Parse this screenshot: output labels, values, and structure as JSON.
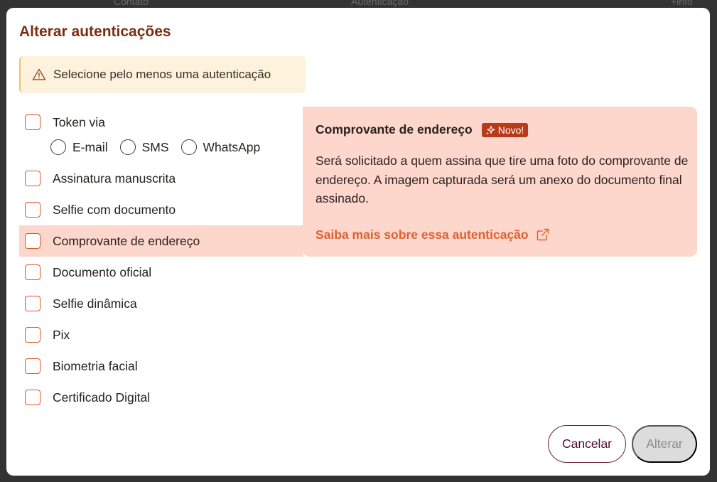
{
  "backdrop": {
    "col1": "Contato",
    "col2": "Autenticação",
    "col3": "+info"
  },
  "modal": {
    "title": "Alterar autenticações",
    "alert": {
      "icon": "warning-triangle-icon",
      "text": "Selecione pelo menos uma autenticação"
    },
    "options": [
      {
        "label": "Token via",
        "checked": false
      },
      {
        "label": "Assinatura manuscrita",
        "checked": false
      },
      {
        "label": "Selfie com documento",
        "checked": false
      },
      {
        "label": "Comprovante de endereço",
        "checked": false,
        "highlighted": true
      },
      {
        "label": "Documento oficial",
        "checked": false
      },
      {
        "label": "Selfie dinâmica",
        "checked": false
      },
      {
        "label": "Pix",
        "checked": false
      },
      {
        "label": "Biometria facial",
        "checked": false
      },
      {
        "label": "Certificado Digital",
        "checked": false
      }
    ],
    "token_channels": [
      {
        "label": "E-mail",
        "selected": false
      },
      {
        "label": "SMS",
        "selected": false
      },
      {
        "label": "WhatsApp",
        "selected": false
      }
    ],
    "info": {
      "title": "Comprovante de endereço",
      "badge": "Novo!",
      "badge_icon": "sparkles-icon",
      "description": "Será solicitado a quem assina que tire uma foto do comprovante de endereço. A imagem capturada será um anexo do documento final assinado.",
      "link_text": "Saiba mais sobre essa autenticação",
      "link_icon": "external-link-icon"
    },
    "buttons": {
      "cancel": "Cancelar",
      "confirm": "Alterar"
    }
  },
  "colors": {
    "title": "#7a2e12",
    "accent": "#d9582a",
    "highlight_bg": "#fdd7cc",
    "alert_bg": "#fdf3dc",
    "badge_bg": "#b83a1a",
    "link": "#e0602e",
    "cancel_border": "#6b1e3e",
    "disabled_bg": "#dcdcdc"
  }
}
